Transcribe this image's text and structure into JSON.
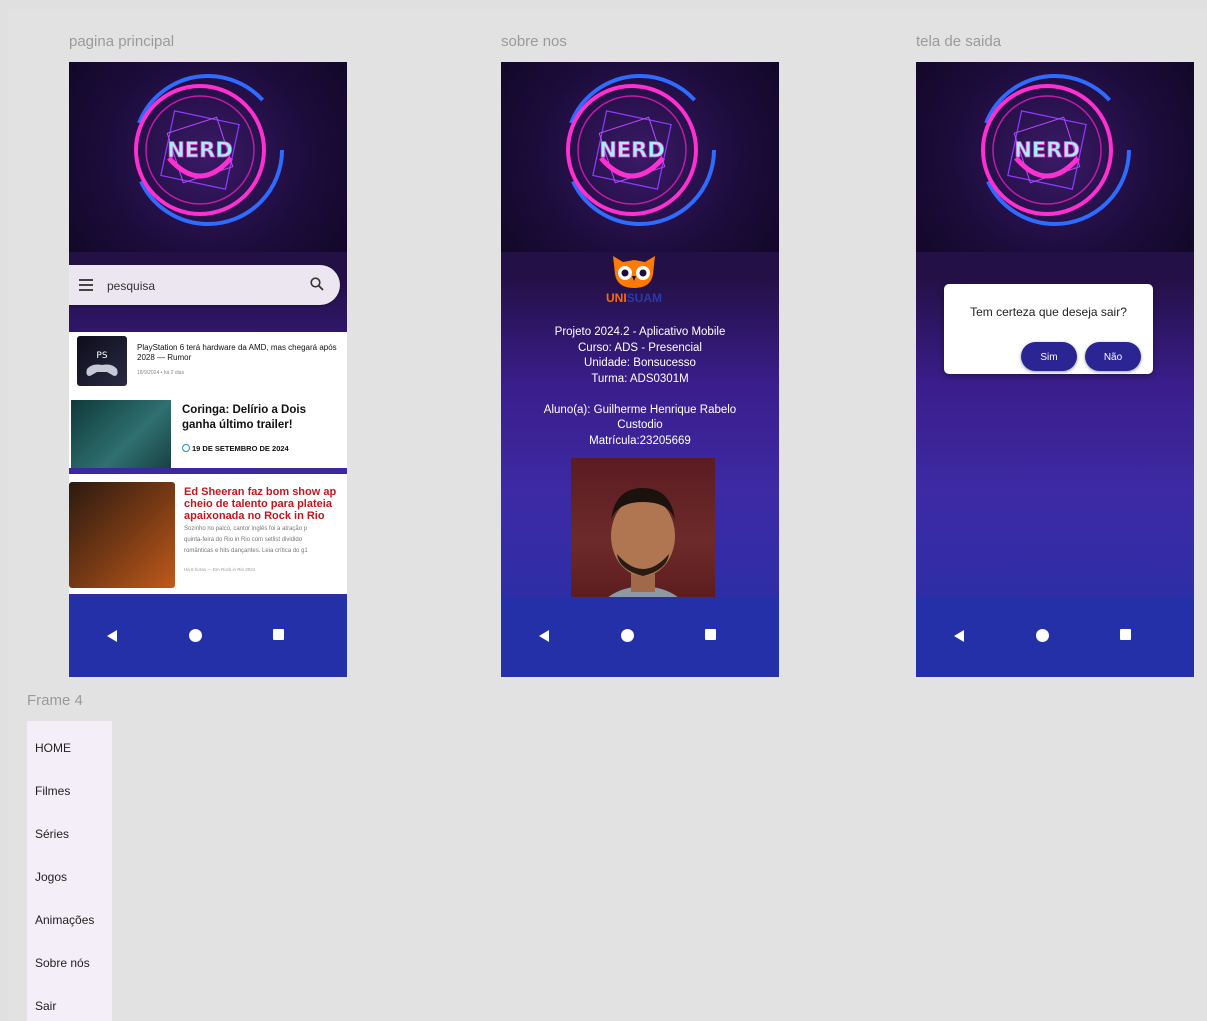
{
  "frames": {
    "main_label": "pagina principal",
    "about_label": "sobre nos",
    "exit_label": "tela de saida",
    "menu_label": "Frame 4"
  },
  "logo": {
    "text": "NERD"
  },
  "search": {
    "placeholder": "pesquisa"
  },
  "news": [
    {
      "headline": "PlayStation 6 terá hardware da AMD, mas chegará após 2028 — Rumor",
      "meta": "18/9/2024 • há 2 dias"
    },
    {
      "headline": "Coringa: Delírio a Dois ganha último trailer!",
      "date": "19 DE SETEMBRO DE 2024"
    },
    {
      "headline_lines": [
        "Ed Sheeran faz bom show ap",
        "cheio de talento para plateia",
        "apaixonada no Rock in Rio"
      ],
      "excerpt_lines": [
        "Sozinho no palco, cantor inglês foi a atração p",
        "quinta-feira do Rio in Rio com setlist dividido",
        "românticas e hits dançantes. Leia crítica do g1"
      ],
      "meta": "Há 8 horas — Em Rock in Rio 2024"
    }
  ],
  "about": {
    "brand_uni": "UNI",
    "brand_suam": "SUAM",
    "lines": [
      "Projeto 2024.2 - Aplicativo Mobile",
      "Curso: ADS - Presencial",
      "Unidade: Bonsucesso",
      "Turma: ADS0301M",
      "",
      "Aluno(a): Guilherme Henrique Rabelo",
      "Custodio",
      "Matrícula:23205669"
    ]
  },
  "dialog": {
    "question": "Tem certeza que deseja sair?",
    "yes": "Sim",
    "no": "Não"
  },
  "menu": {
    "items": [
      "HOME",
      "Filmes",
      "Séries",
      "Jogos",
      "Animações",
      "Sobre nós",
      "Sair"
    ]
  },
  "colors": {
    "canvas": "#e2e2e2",
    "navbar": "#2330a8",
    "dialog_button": "#2a2592",
    "neon_pink": "#ff2fd0",
    "neon_blue": "#2f6bff"
  }
}
